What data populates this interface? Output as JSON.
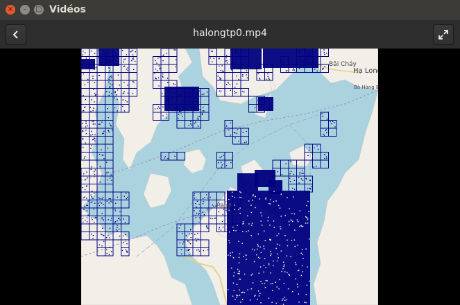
{
  "window": {
    "title": "Vidéos",
    "close_glyph": "×",
    "minimize_glyph": "–",
    "maximize_glyph": "□"
  },
  "header": {
    "filename": "halongtp0.mp4",
    "back_icon": "chevron-left-icon",
    "fullscreen_icon": "fullscreen-icon"
  },
  "map": {
    "labels": {
      "bai_chay": "Bãi Cháy",
      "ha_long": "Hạ Long",
      "ba_hang_bai": "Bà Hàng Bãi",
      "hang": "Hang"
    },
    "colors": {
      "water": "#aad3df",
      "land": "#f2efe9",
      "heat": "#000080",
      "grid_line": "#000080"
    }
  }
}
